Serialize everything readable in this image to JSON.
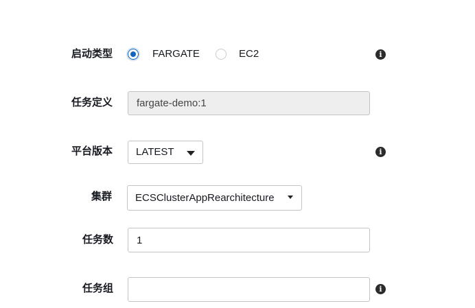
{
  "form": {
    "launch_type": {
      "label": "启动类型",
      "options": [
        {
          "label": "FARGATE",
          "selected": true
        },
        {
          "label": "EC2",
          "selected": false
        }
      ],
      "info_icon": "info-icon"
    },
    "task_definition": {
      "label": "任务定义",
      "value": "fargate-demo:1",
      "disabled": true
    },
    "platform_version": {
      "label": "平台版本",
      "value": "LATEST",
      "info_icon": "info-icon"
    },
    "cluster": {
      "label": "集群",
      "value": "ECSClusterAppRearchitecture"
    },
    "task_count": {
      "label": "任务数",
      "value": "1"
    },
    "task_group": {
      "label": "任务组",
      "value": "",
      "info_icon": "info-icon"
    }
  },
  "icons": {
    "info_glyph": "i"
  },
  "colors": {
    "accent": "#1166bb",
    "text": "#16191f",
    "border": "#c0c4c8",
    "disabled_bg": "#eeeeee"
  }
}
